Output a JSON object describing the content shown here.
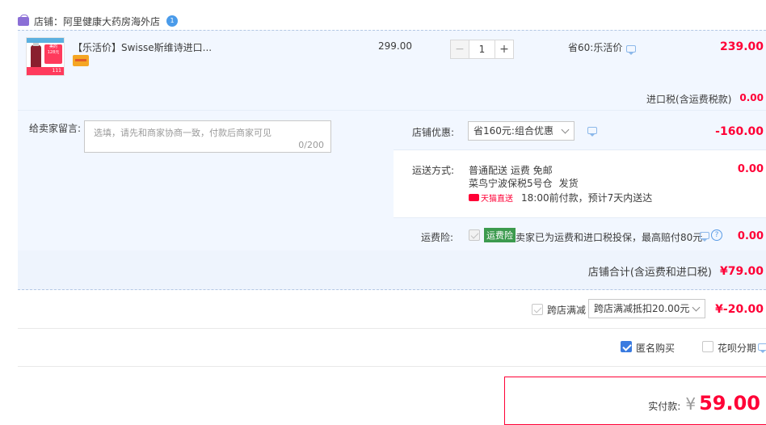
{
  "shop": {
    "label": "店铺：阿里健康大药房海外店",
    "badge": "1"
  },
  "product": {
    "title": "【乐活价】Swisse斯维诗进口...",
    "thumb_text_a": "美的",
    "thumb_text_b": "128元",
    "thumb_text_c": "111",
    "price": "299.00",
    "quantity": "1",
    "minus": "−",
    "plus": "+",
    "promo": "省60:乐活价",
    "subtotal": "239.00",
    "import_tax_label": "进口税(含运费税款)",
    "import_tax_value": "0.00"
  },
  "message": {
    "label": "给卖家留言:",
    "placeholder": "选填，请先和商家协商一致，付款后商家可见",
    "counter": "0/200"
  },
  "shop_discount": {
    "label": "店铺优惠:",
    "selected": "省160元:组合优惠",
    "amount": "-160.00"
  },
  "shipping": {
    "label": "运送方式:",
    "line1": "普通配送 运费 免邮",
    "line2_a": "菜鸟宁波保税5号仓",
    "line2_b": "发货",
    "tmall_tag": "天猫直送",
    "line3": "18:00前付款，预计7天内送达",
    "amount": "0.00"
  },
  "shipping_insurance": {
    "label": "运费险:",
    "tag": "运费险",
    "text": "卖家已为运费和进口税投保，最高赔付80元",
    "help": "?",
    "amount": "0.00"
  },
  "shop_total": {
    "label": "店铺合计(含运费和进口税)",
    "amount": "¥79.00"
  },
  "cross_shop": {
    "label": "跨店满减",
    "selected": "跨店满减抵扣20.00元",
    "amount": "¥-20.00"
  },
  "options": {
    "anonymous": "匿名购买",
    "huabei": "花呗分期"
  },
  "payment": {
    "label": "实付款:",
    "currency": "¥",
    "amount": "59.00"
  },
  "colors": {
    "accent_red": "#ff0036",
    "row_blue": "#f2f7ff",
    "link_blue": "#3a7be0",
    "insurance_green": "#3c9a4e"
  }
}
